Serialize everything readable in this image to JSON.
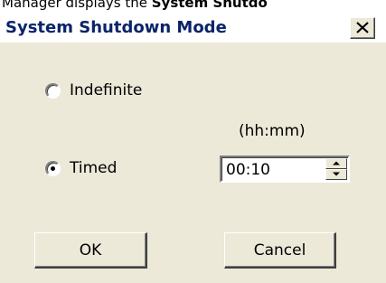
{
  "context": {
    "prefix": "Manager displays the ",
    "bold": "System Shutdo"
  },
  "dialog": {
    "title": "System Shutdown Mode",
    "close_label": "×"
  },
  "options": {
    "indefinite_label": "Indefinite",
    "timed_label": "Timed",
    "selected": "timed"
  },
  "time": {
    "unit_label": "(hh:mm)",
    "value": "00:10"
  },
  "buttons": {
    "ok_label": "OK",
    "cancel_label": "Cancel"
  },
  "colors": {
    "dialog_bg": "#ece9d8",
    "title_text": "#0a246a"
  }
}
